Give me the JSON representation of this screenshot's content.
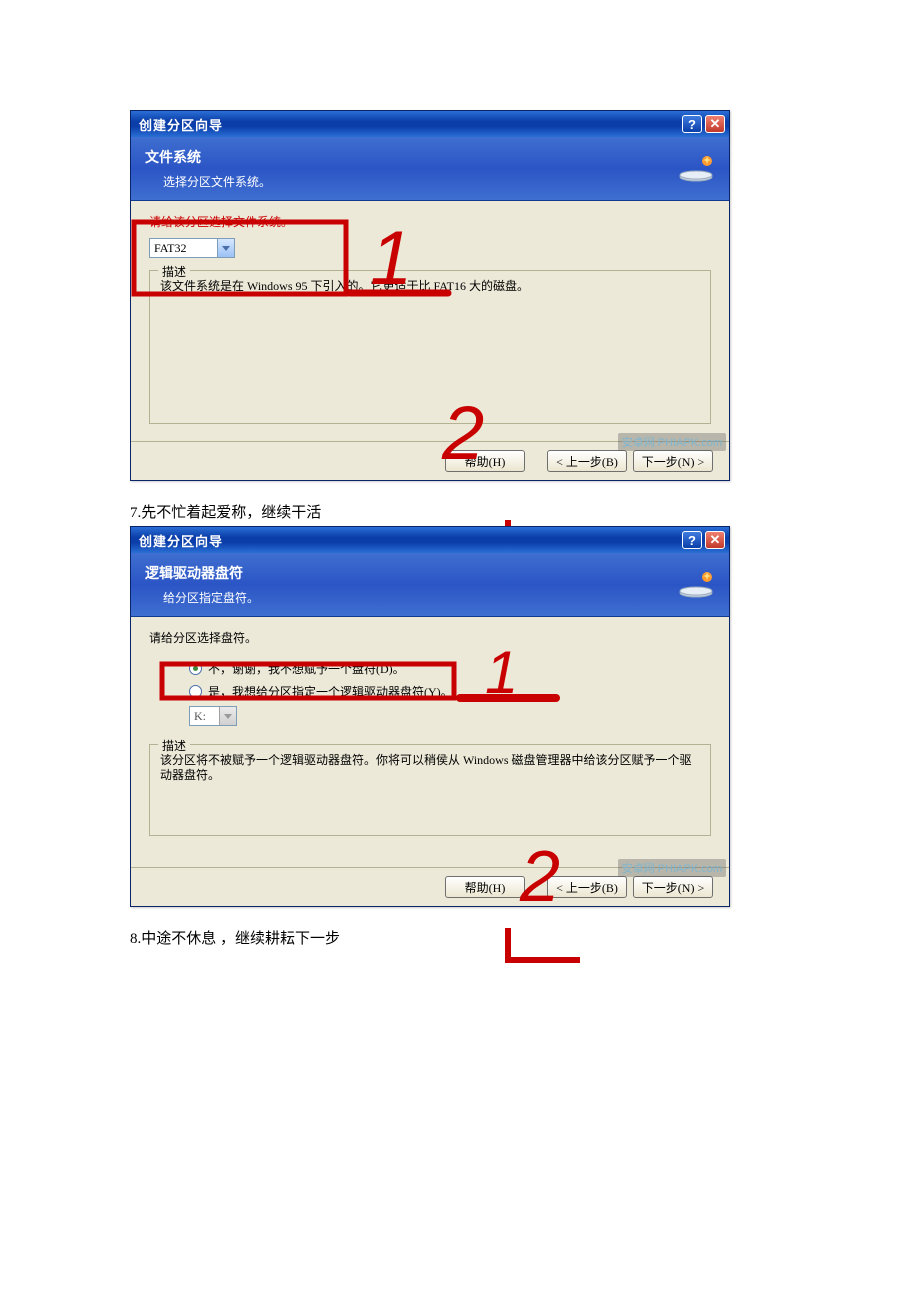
{
  "dialog1": {
    "title": "创建分区向导",
    "header_title": "文件系统",
    "header_sub": "选择分区文件系统。",
    "prompt_line": "请给该分区选择文件系统。",
    "select_value": "FAT32",
    "legend": "描述",
    "desc_text": "该文件系统是在 Windows 95 下引入的。它更适于比 FAT16 大的磁盘。",
    "btn_help": "帮助(H)",
    "btn_back": "< 上一步(B)",
    "btn_next": "下一步(N) >",
    "watermark": "安卓网 PHIAPK.com",
    "anno1": "1",
    "anno2": "2"
  },
  "caption7": "7.先不忙着起爱称，继续干活",
  "dialog2": {
    "title": "创建分区向导",
    "header_title": "逻辑驱动器盘符",
    "header_sub": "给分区指定盘符。",
    "prompt_line": "请给分区选择盘符。",
    "radio_no": "不，谢谢，我不想赋予一个盘符(D)。",
    "radio_yes": "是，我想给分区指定一个逻辑驱动器盘符(Y)。",
    "drive_value": "K:",
    "legend": "描述",
    "desc_text": "该分区将不被赋予一个逻辑驱动器盘符。你将可以稍侯从 Windows 磁盘管理器中给该分区赋予一个驱动器盘符。",
    "btn_help": "帮助(H)",
    "btn_back": "< 上一步(B)",
    "btn_next": "下一步(N) >",
    "watermark": "安卓网 PHIAPK.com",
    "anno1": "1",
    "anno2": "2"
  },
  "caption8": "8.中途不休息 ，继续耕耘下一步"
}
